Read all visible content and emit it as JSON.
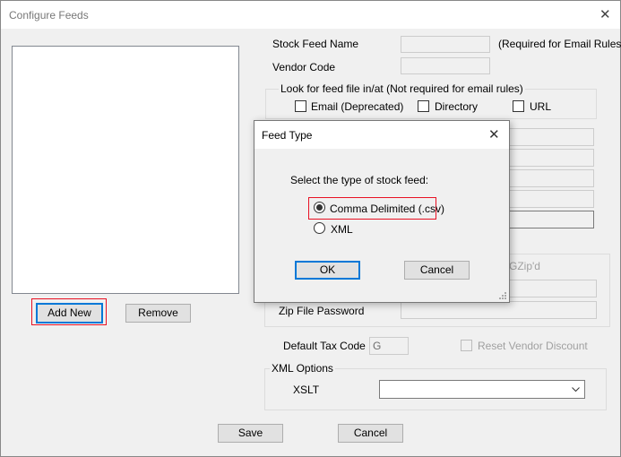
{
  "window": {
    "title": "Configure Feeds",
    "close": "✕"
  },
  "left": {
    "add_new": "Add New",
    "remove": "Remove"
  },
  "form": {
    "stock_feed_name_label": "Stock Feed Name",
    "stock_feed_name_note": "(Required for Email Rules)",
    "vendor_code_label": "Vendor Code",
    "look_for_legend": "Look for feed file in/at (Not required for email rules)",
    "email_label": "Email (Deprecated)",
    "directory_label": "Directory",
    "url_label": "URL",
    "gzip_label": "GZip'd",
    "zip_password_label": "Zip File Password",
    "tax_code_label": "Default Tax Code",
    "tax_code_value": "G",
    "reset_vendor_discount": "Reset Vendor Discount",
    "xml_options_legend": "XML Options",
    "xslt_label": "XSLT",
    "xslt_value": ""
  },
  "footer": {
    "save": "Save",
    "cancel": "Cancel"
  },
  "dialog": {
    "title": "Feed Type",
    "close": "✕",
    "prompt": "Select the type of stock feed:",
    "options": [
      {
        "label": "Comma Delimited (.csv)",
        "selected": true
      },
      {
        "label": "XML",
        "selected": false
      }
    ],
    "ok": "OK",
    "cancel": "Cancel"
  },
  "colors": {
    "highlight": "#e81123",
    "focus": "#0078d7"
  }
}
